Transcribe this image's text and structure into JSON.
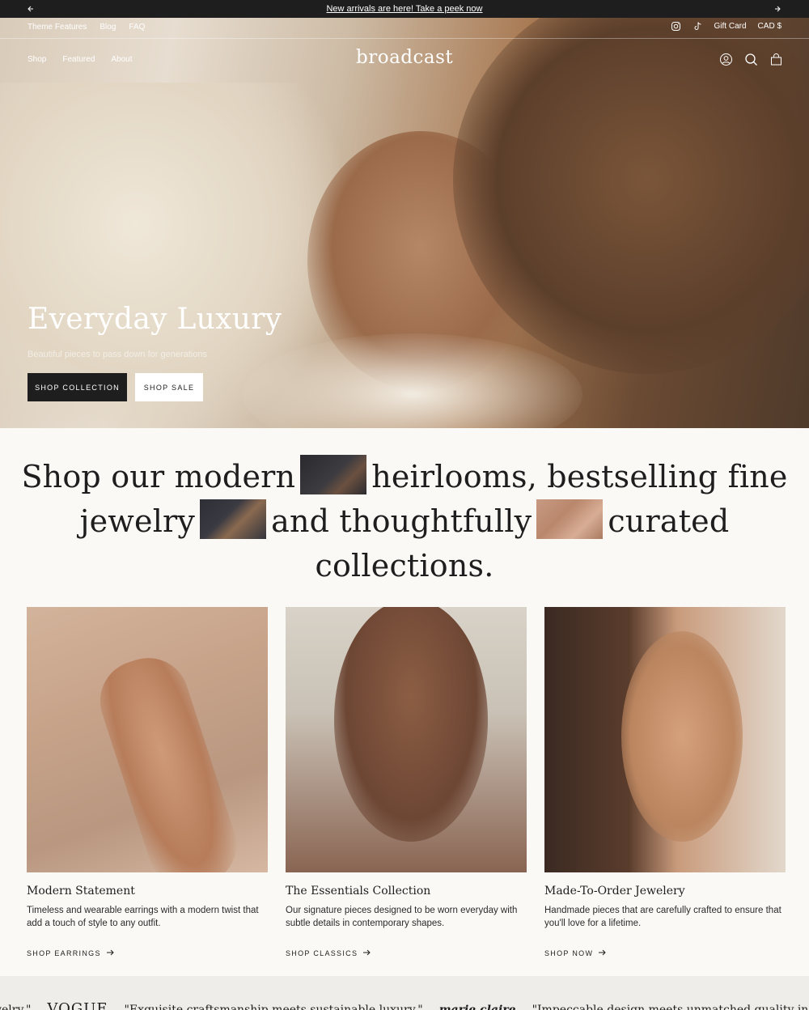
{
  "announcement": {
    "text": "New arrivals are here! Take a peek now"
  },
  "utility_nav": {
    "links": [
      "Theme Features",
      "Blog",
      "FAQ"
    ],
    "gift_card": "Gift Card",
    "currency": "CAD $"
  },
  "main_nav": {
    "links": [
      "Shop",
      "Featured",
      "About"
    ],
    "logo": "broadcast"
  },
  "hero": {
    "title": "Everyday Luxury",
    "subtitle": "Beautiful pieces to pass down for generations",
    "primary_button": "SHOP COLLECTION",
    "secondary_button": "SHOP SALE"
  },
  "statement": {
    "part1": "Shop our modern",
    "part2": "heirlooms, bestselling fine",
    "part3": "jewelry",
    "part4": "and thoughtfully",
    "part5": "curated",
    "part6": "collections."
  },
  "collections": [
    {
      "title": "Modern Statement",
      "description": "Timeless and wearable earrings with a modern twist that add a touch of style to any outfit.",
      "link": "SHOP EARRINGS"
    },
    {
      "title": "The Essentials Collection",
      "description": "Our signature pieces designed to be worn everyday with subtle details in contemporary shapes.",
      "link": "SHOP CLASSICS"
    },
    {
      "title": "Made-To-Order Jewelery",
      "description": "Handmade pieces that are carefully crafted to ensure that you'll love for a lifetime.",
      "link": "SHOP NOW"
    }
  ],
  "press": {
    "quote_tail": "welry.\"",
    "logo1": "VOGUE",
    "quote1": "\"Exquisite craftsmanship meets sustainable luxury.\"",
    "logo2": "marie claire",
    "quote2": "\"Impeccable design meets unmatched quality in every piece"
  },
  "colors": {
    "announcement_bg": "#1e1e1e",
    "page_bg": "#faf9f6",
    "press_bg": "#eeede9",
    "button_dark": "#1e1e1e"
  }
}
